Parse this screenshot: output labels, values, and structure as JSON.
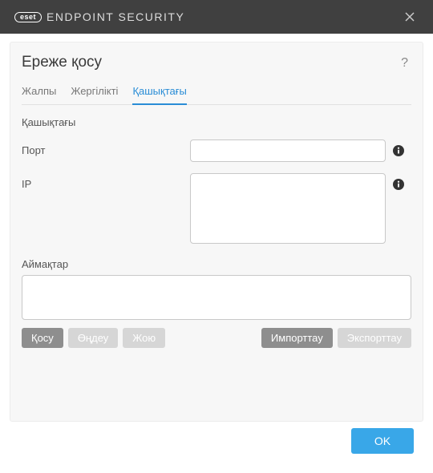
{
  "titlebar": {
    "brand_badge": "eset",
    "brand_text": "ENDPOINT SECURITY"
  },
  "dialog": {
    "title": "Ереже қосу"
  },
  "tabs": {
    "general": "Жалпы",
    "local": "Жергілікті",
    "remote": "Қашықтағы"
  },
  "section": {
    "remote_heading": "Қашықтағы"
  },
  "fields": {
    "port_label": "Порт",
    "port_value": "",
    "ip_label": "IP",
    "ip_value": "",
    "zones_label": "Аймақтар"
  },
  "buttons": {
    "add": "Қосу",
    "edit": "Өңдеу",
    "delete": "Жою",
    "import": "Импорттау",
    "export": "Экспорттау",
    "ok": "OK"
  }
}
